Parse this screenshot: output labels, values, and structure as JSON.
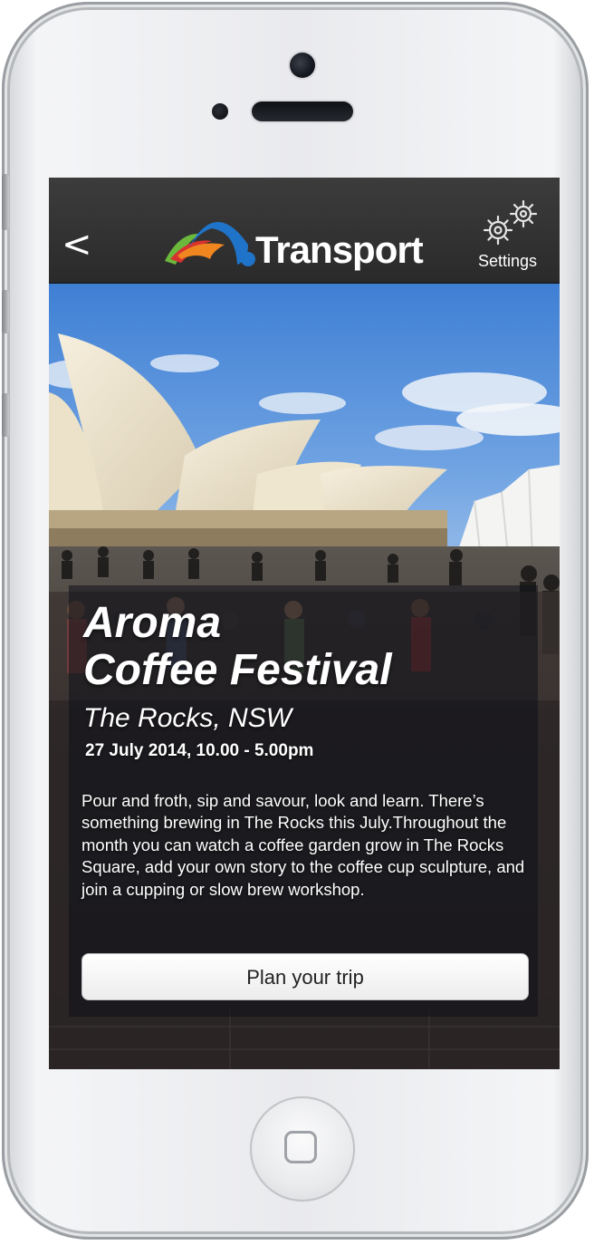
{
  "header": {
    "back_label": "<",
    "brand": "Transport",
    "settings_label": "Settings",
    "icons": {
      "back": "chevron-left-icon",
      "settings": "gears-icon",
      "logo": "transport-logo"
    }
  },
  "event": {
    "title_line1": "Aroma",
    "title_line2": "Coffee Festival",
    "location": "The Rocks, NSW",
    "date": "27 July 2014, 10.00 - 5.00pm",
    "description": "Pour and froth, sip and savour, look and learn. There’s something brewing in The Rocks this July.Throughout the month you can watch a coffee garden grow in The Rocks Square, add your own story to the coffee cup sculpture, and join a cupping or slow brew workshop.",
    "cta_label": "Plan your trip"
  },
  "colors": {
    "topbar": "#333333",
    "logo_blue": "#1f74c9",
    "logo_orange": "#f0861f",
    "logo_green": "#6bb83d",
    "logo_red": "#d8322f"
  }
}
